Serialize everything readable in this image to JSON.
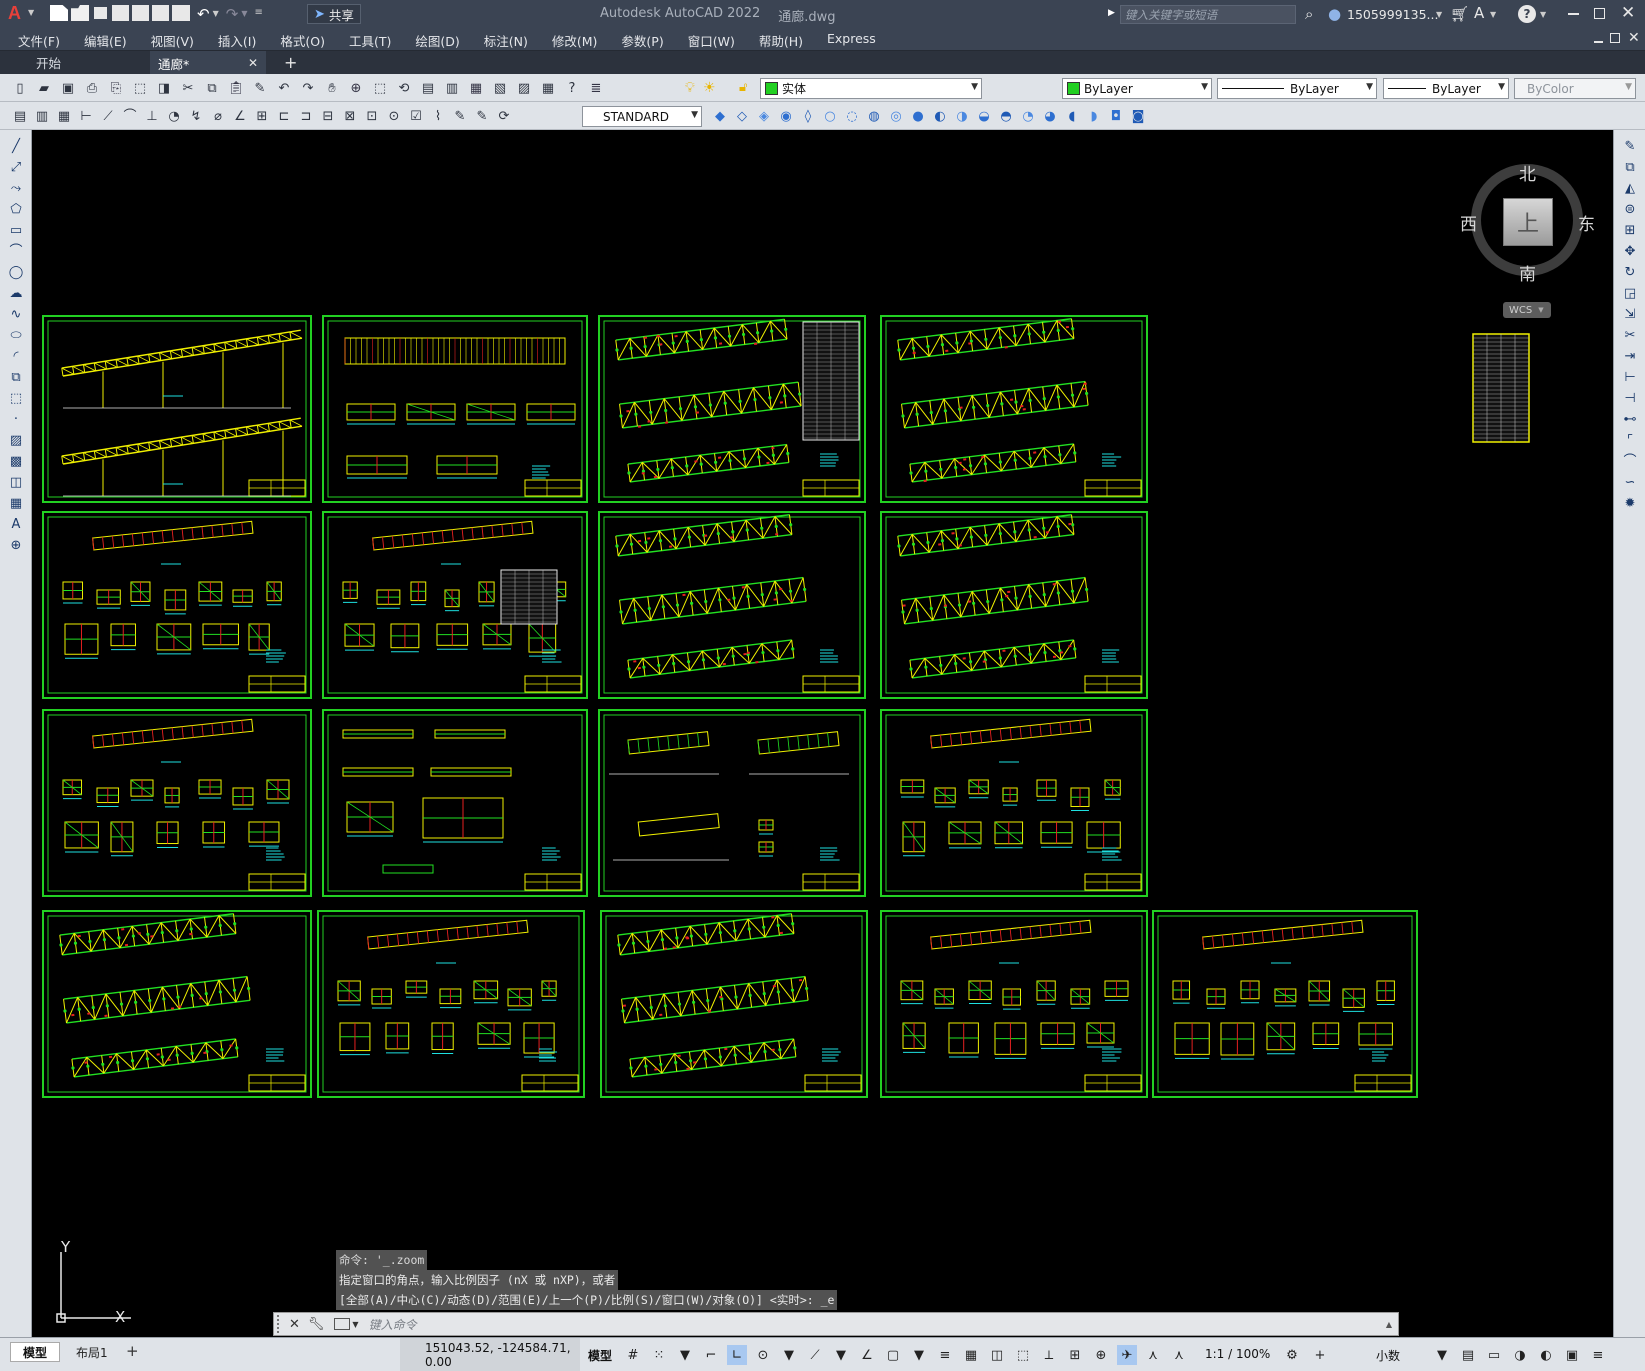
{
  "title": {
    "app_name": "Autodesk AutoCAD 2022",
    "file_name": "通廊.dwg",
    "logo": "A",
    "share_label": "共享",
    "search_placeholder": "键入关键字或短语",
    "user": "1505999135...",
    "help": "?"
  },
  "menu": [
    "文件(F)",
    "编辑(E)",
    "视图(V)",
    "插入(I)",
    "格式(O)",
    "工具(T)",
    "绘图(D)",
    "标注(N)",
    "修改(M)",
    "参数(P)",
    "窗口(W)",
    "帮助(H)",
    "Express"
  ],
  "tabs": {
    "start": "开始",
    "active": "通廊*",
    "close": "✕",
    "add": "+"
  },
  "toolbar": {
    "layer_value": "实体",
    "color_value": "ByLayer",
    "linetype_value": "ByLayer",
    "lineweight_value": "ByLayer",
    "plotstyle_value": "ByColor",
    "dimstyle_value": "STANDARD"
  },
  "viewcube": {
    "north": "北",
    "south": "南",
    "east": "东",
    "west": "西",
    "top": "上",
    "wcs": "WCS"
  },
  "ucs": {
    "y": "Y",
    "x": "X"
  },
  "command": {
    "history": [
      "命令: '_.zoom",
      "指定窗口的角点，输入比例因子 (nX 或 nXP)，或者",
      "[全部(A)/中心(C)/动态(D)/范围(E)/上一个(P)/比例(S)/窗口(W)/对象(O)] <实时>: _e"
    ],
    "placeholder": "键入命令"
  },
  "status": {
    "model_tab": "模型",
    "layout_tab": "布局1",
    "add": "+",
    "coords": "151043.52, -124584.71, 0.00",
    "space": "模型",
    "scale": "1:1 / 100%",
    "units": "小数"
  },
  "colors": {
    "sheet_border": "#22d022",
    "line_yellow": "#f0f000",
    "line_green": "#22e022",
    "line_red": "#e62020",
    "line_cyan": "#1ee0e0",
    "line_white": "#e8e8e8",
    "title_bg": "#3b4453",
    "toolbar_bg": "#dfe3e8"
  },
  "icons": {
    "search": "search-icon",
    "user": "user-icon",
    "cart": "cart-icon",
    "help": "help-icon",
    "minimize": "minimize-icon",
    "maximize": "maximize-icon",
    "close": "close-icon"
  }
}
